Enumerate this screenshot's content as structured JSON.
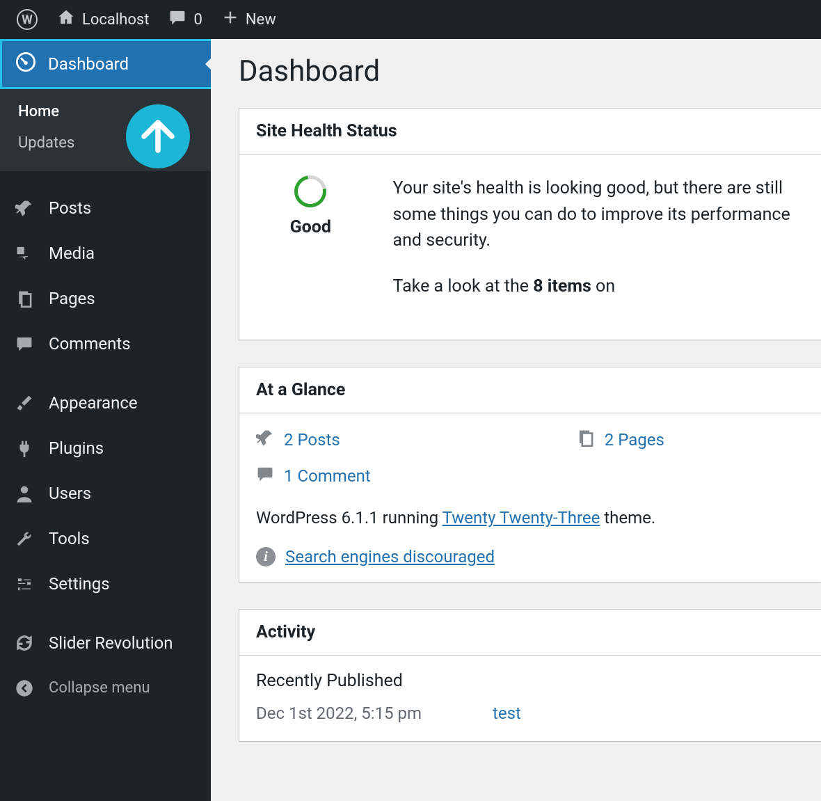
{
  "adminbar": {
    "site_name": "Localhost",
    "comment_count": "0",
    "new_label": "New"
  },
  "sidebar": {
    "dashboard_label": "Dashboard",
    "submenu": {
      "home": "Home",
      "updates": "Updates"
    },
    "items": [
      {
        "label": "Posts",
        "icon": "pin-icon"
      },
      {
        "label": "Media",
        "icon": "media-icon"
      },
      {
        "label": "Pages",
        "icon": "pages-icon"
      },
      {
        "label": "Comments",
        "icon": "comment-icon"
      },
      {
        "label": "Appearance",
        "icon": "brush-icon"
      },
      {
        "label": "Plugins",
        "icon": "plug-icon"
      },
      {
        "label": "Users",
        "icon": "user-icon"
      },
      {
        "label": "Tools",
        "icon": "wrench-icon"
      },
      {
        "label": "Settings",
        "icon": "sliders-icon"
      },
      {
        "label": "Slider Revolution",
        "icon": "refresh-icon"
      }
    ],
    "collapse_label": "Collapse menu"
  },
  "page": {
    "title": "Dashboard"
  },
  "site_health": {
    "header": "Site Health Status",
    "status_label": "Good",
    "text1": "Your site's health is looking good, but there are still some things you can do to improve its performance and security.",
    "text2_prefix": "Take a look at the ",
    "items_bold": "8 items",
    "text2_suffix": " on"
  },
  "glance": {
    "header": "At a Glance",
    "posts": "2 Posts",
    "pages": "2 Pages",
    "comments": "1 Comment",
    "wp_text_prefix": "WordPress 6.1.1 running ",
    "theme_link": "Twenty Twenty-Three",
    "wp_text_suffix": " theme.",
    "search_discouraged": "Search engines discouraged"
  },
  "activity": {
    "header": "Activity",
    "recently_published": "Recently Published",
    "items": [
      {
        "date": "Dec 1st 2022, 5:15 pm",
        "title": "test"
      }
    ]
  }
}
